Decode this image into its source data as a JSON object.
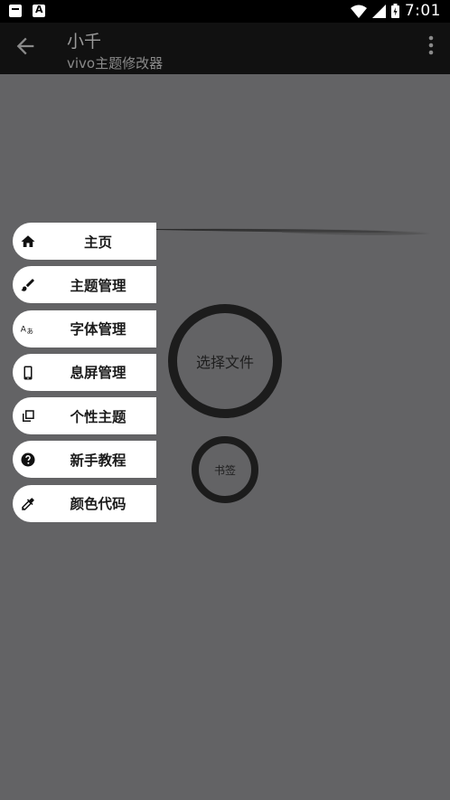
{
  "status_bar": {
    "time": "7:01",
    "icons": [
      "message-icon",
      "a-app-icon",
      "wifi-icon",
      "signal-icon",
      "battery-icon"
    ]
  },
  "app_bar": {
    "title": "小千",
    "subtitle": "vivo主题修改器",
    "back_icon": "arrow-back-icon",
    "menu_icon": "more-vert-icon"
  },
  "menu": {
    "items": [
      {
        "label": "主页",
        "icon": "home-icon"
      },
      {
        "label": "主题管理",
        "icon": "brush-icon"
      },
      {
        "label": "字体管理",
        "icon": "translate-icon"
      },
      {
        "label": "息屏管理",
        "icon": "phone-icon"
      },
      {
        "label": "个性主题",
        "icon": "copy-icon"
      },
      {
        "label": "新手教程",
        "icon": "help-icon"
      },
      {
        "label": "颜色代码",
        "icon": "eyedropper-icon"
      }
    ]
  },
  "main": {
    "select_file_label": "选择文件",
    "bookmark_label": "书签"
  },
  "colors": {
    "background": "#636365",
    "app_bar": "#111111",
    "menu_item": "#ffffff",
    "ring": "#1c1c1c"
  }
}
